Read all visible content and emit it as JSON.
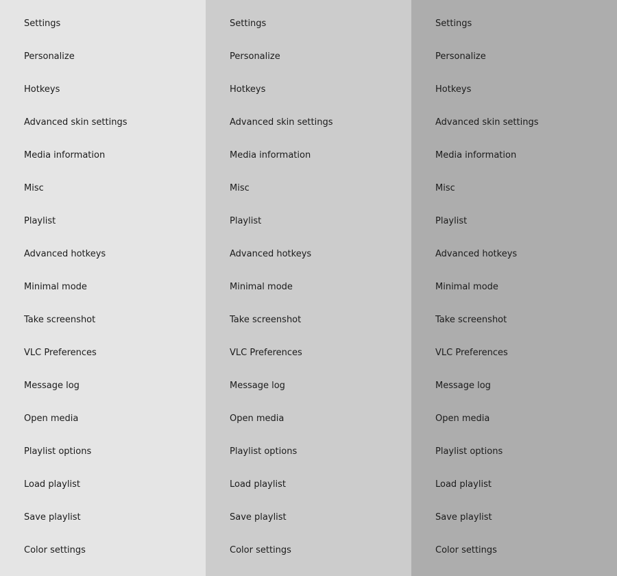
{
  "menu": {
    "items": [
      "Settings",
      "Personalize",
      "Hotkeys",
      "Advanced skin settings",
      "Media information",
      "Misc",
      "Playlist",
      "Advanced hotkeys",
      "Minimal mode",
      "Take screenshot",
      "VLC Preferences",
      "Message log",
      "Open media",
      "Playlist options",
      "Load playlist",
      "Save playlist",
      "Color settings"
    ]
  },
  "columns": [
    {
      "state": "normal",
      "background": "#e5e5e5"
    },
    {
      "state": "hover",
      "background": "#cccccc"
    },
    {
      "state": "pressed",
      "background": "#adadad"
    }
  ]
}
